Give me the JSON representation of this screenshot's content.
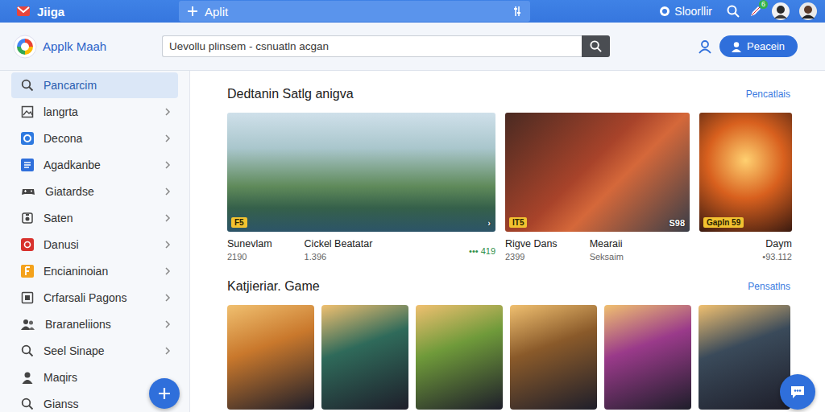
{
  "topbar": {
    "app_name": "Jiiga",
    "tab_label": "Aplit",
    "user": "Sloorllir",
    "badge": "6"
  },
  "header": {
    "brand": "Applk Maah",
    "search": {
      "value": "Uevollu plinsem - csnuatln acgan"
    },
    "button": "Peacein"
  },
  "sidebar": {
    "items": [
      {
        "label": "Pancarcim",
        "selected": true,
        "expandable": false
      },
      {
        "label": "langrta",
        "selected": false,
        "expandable": true
      },
      {
        "label": "Decona",
        "selected": false,
        "expandable": true
      },
      {
        "label": "Agadkanbe",
        "selected": false,
        "expandable": true
      },
      {
        "label": "Giatardse",
        "selected": false,
        "expandable": true
      },
      {
        "label": "Saten",
        "selected": false,
        "expandable": true
      },
      {
        "label": "Danusi",
        "selected": false,
        "expandable": true
      },
      {
        "label": "Encianinoian",
        "selected": false,
        "expandable": true
      },
      {
        "label": "Crfarsali Pagons",
        "selected": false,
        "expandable": true
      },
      {
        "label": "Braraneliions",
        "selected": false,
        "expandable": true
      },
      {
        "label": "Seel Sinape",
        "selected": false,
        "expandable": true
      },
      {
        "label": "Maqirs",
        "selected": false,
        "expandable": false
      },
      {
        "label": "Gianss",
        "selected": false,
        "expandable": false
      }
    ]
  },
  "featured": {
    "title": "Dedtanin Satlg anigva",
    "link": "Pencatlais",
    "cards": [
      {
        "tag": "F5",
        "tag_right": "›",
        "color": "#5f8a5a",
        "captions": [
          {
            "title": "Sunevlam",
            "sub": "2190"
          },
          {
            "title": "Cickel Beatatar",
            "sub": "1.396"
          }
        ],
        "rating": "••• 419"
      },
      {
        "tag": "IT5",
        "tag_right": "S98",
        "color": "#a8432a",
        "captions": [
          {
            "title": "Rigve Dans",
            "sub": "2399"
          },
          {
            "title": "Mearaii",
            "sub": "Seksaim"
          }
        ]
      },
      {
        "tag": "Gapln 59",
        "color": "#d8601e",
        "captions": [
          {
            "title": "Daym",
            "sub": "•93.112"
          }
        ]
      }
    ]
  },
  "category": {
    "title": "Katjieriar. Game",
    "link": "Pensatlns",
    "tiles": [
      {
        "color": "#c9782c"
      },
      {
        "color": "#2f6a5a"
      },
      {
        "color": "#6f9a3a"
      },
      {
        "color": "#8a5a2a"
      },
      {
        "color": "#9a3a8a"
      },
      {
        "color": "#3a4a5a"
      }
    ]
  }
}
